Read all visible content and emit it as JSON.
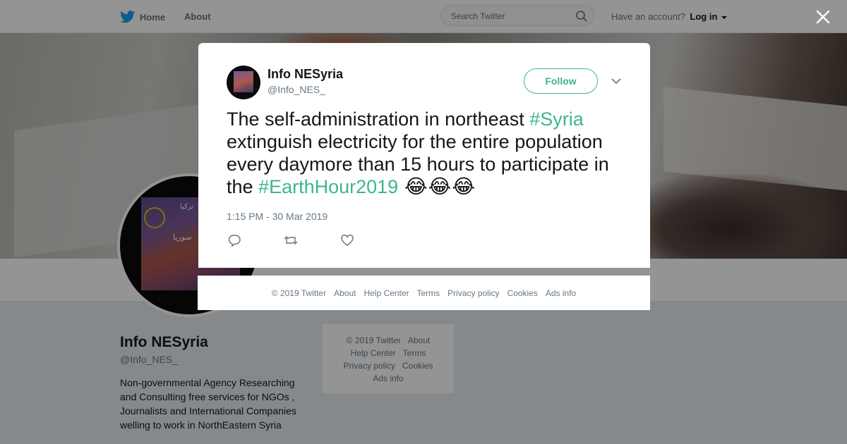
{
  "nav": {
    "home_label": "Home",
    "about_label": "About",
    "search_placeholder": "Search Twitter",
    "account_prompt": "Have an account?",
    "login_label": "Log in"
  },
  "profile": {
    "name": "Info NESyria",
    "handle": "@Info_NES_",
    "bio": "Non-governmental Agency Researching and Consulting free services for NGOs , Journalists and International Companies welling to work in NorthEastern Syria",
    "avatar_text_1": "تركيا",
    "avatar_text_2": "سوريا"
  },
  "side_footer": {
    "links": [
      "© 2019 Twitter",
      "About",
      "Help Center",
      "Terms",
      "Privacy policy",
      "Cookies",
      "Ads info"
    ]
  },
  "tweet": {
    "author_name": "Info NESyria",
    "author_handle": "@Info_NES_",
    "follow_label": "Follow",
    "text_part1": "The self-administration in northeast ",
    "hashtag1": "#Syria",
    "text_part2": " extinguish electricity for the entire population every daymore than 15 hours to participate in the ",
    "hashtag2": "#EarthHour2019",
    "emojis": " 😂😂😂",
    "timestamp": "1:15 PM - 30 Mar 2019"
  },
  "modal_footer": {
    "links": [
      "© 2019 Twitter",
      "About",
      "Help Center",
      "Terms",
      "Privacy policy",
      "Cookies",
      "Ads info"
    ]
  },
  "colors": {
    "accent": "#3fb68b",
    "brand": "#1da1f2",
    "muted_text": "#657786"
  },
  "icons": {
    "brand": "twitter-bird-icon",
    "search": "search-icon",
    "close": "close-icon",
    "menu": "chevron-down-icon",
    "reply": "reply-icon",
    "retweet": "retweet-icon",
    "like": "heart-icon"
  }
}
